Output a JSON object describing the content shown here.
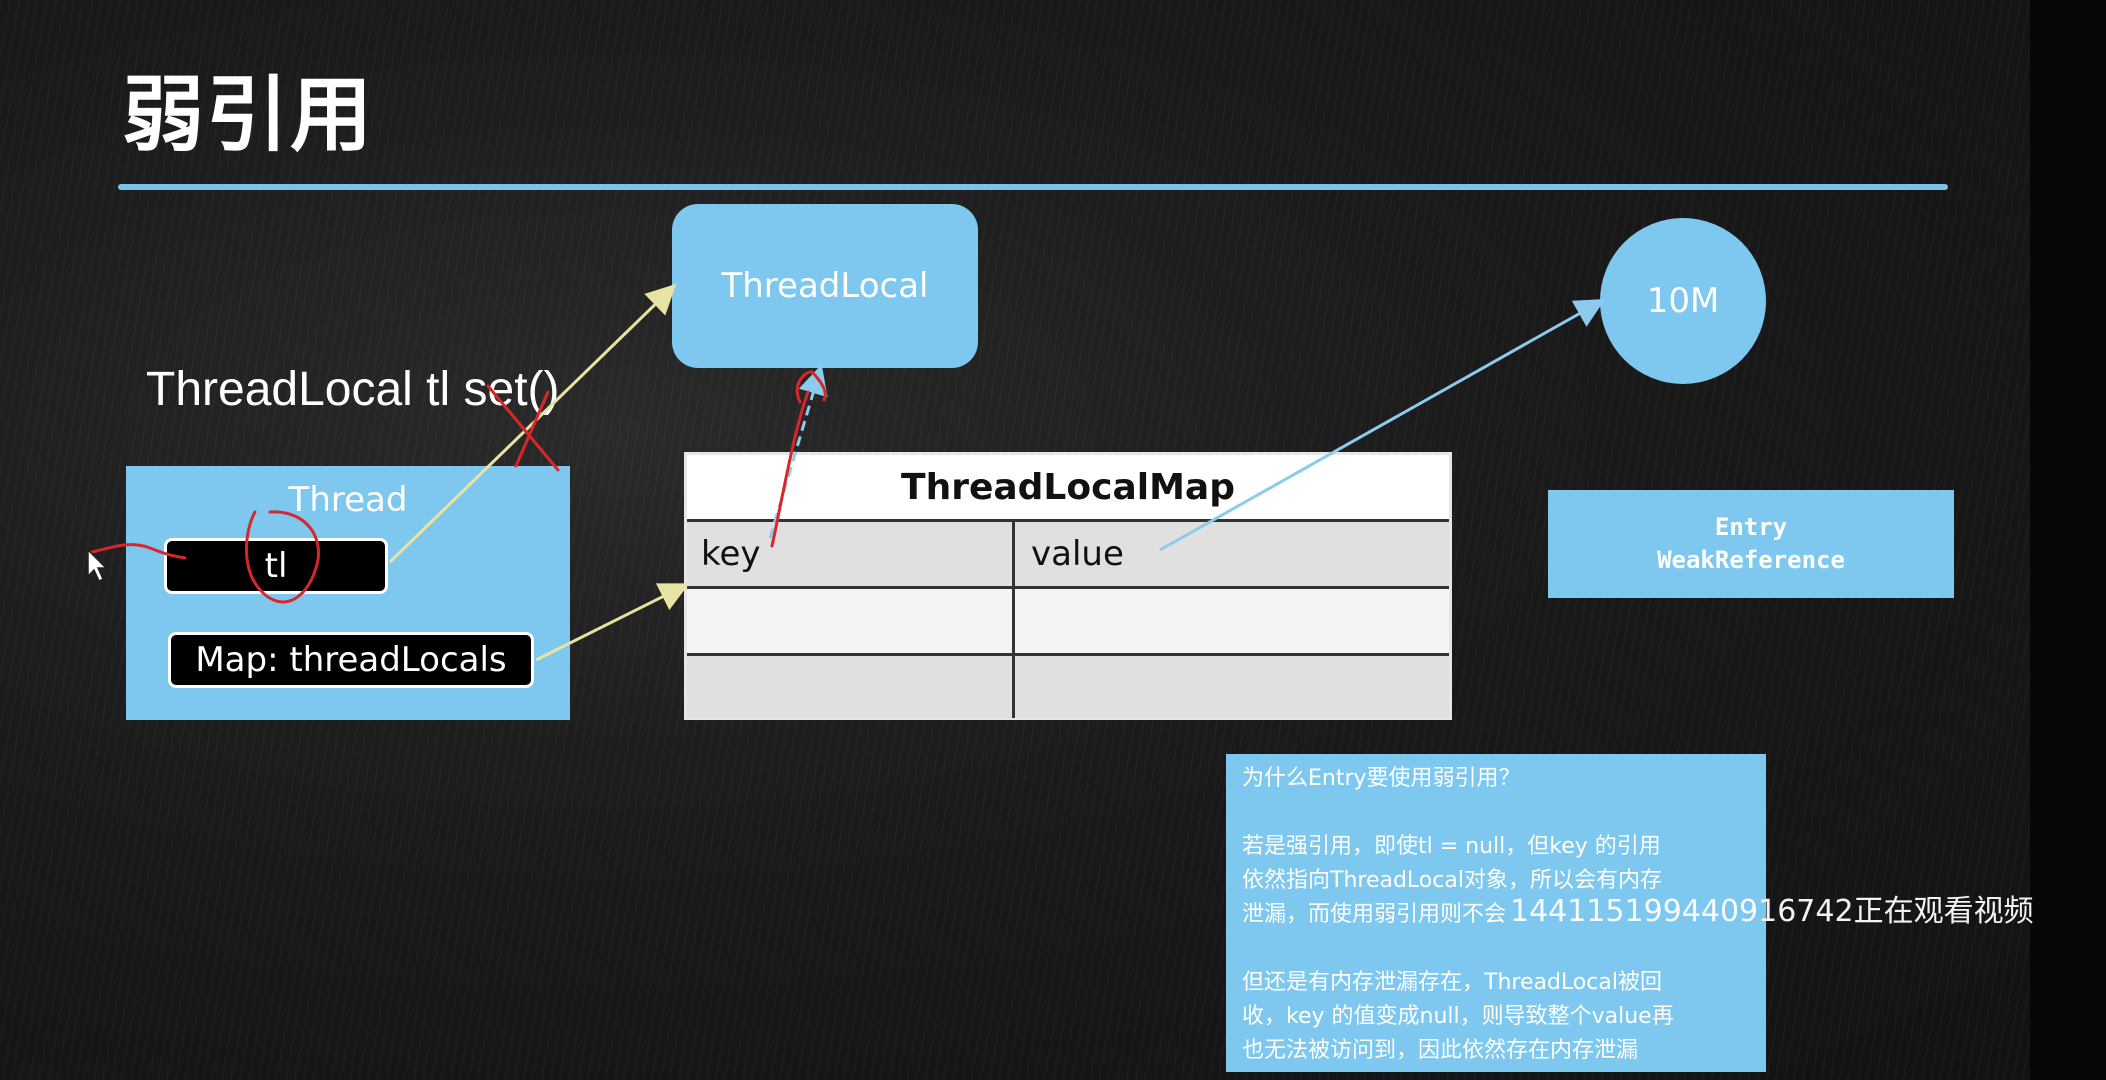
{
  "slide": {
    "title": "弱引用"
  },
  "diagram": {
    "threadlocal_node": "ThreadLocal",
    "big_object": "10M",
    "code_text": "ThreadLocal tl set()",
    "thread": {
      "label": "Thread",
      "tl_field": "tl",
      "map_field": "Map: threadLocals"
    },
    "map_table": {
      "title": "ThreadLocalMap",
      "rows": [
        [
          "key",
          "value"
        ],
        [
          "",
          ""
        ],
        [
          "",
          ""
        ]
      ]
    },
    "entry": {
      "line1": "Entry",
      "line2": "WeakReference"
    }
  },
  "note": {
    "question": "为什么Entry要使用弱引用？",
    "para1": [
      "若是强引用，即使tl = null，但key 的引用",
      "依然指向ThreadLocal对象，所以会有内存",
      "泄漏，而使用弱引用则不会"
    ],
    "para2": [
      "但还是有内存泄漏存在，ThreadLocal被回",
      "收，key 的值变成null，则导致整个value再",
      "也无法被访问到，因此依然存在内存泄漏"
    ]
  },
  "watermark": "14411519944091674​2正在观看视频",
  "colors": {
    "box_blue": "#7ec8ef",
    "arrow_yellow": "#e8e3a0",
    "arrow_blue": "#8ccbec",
    "annotation_red": "#d8262b",
    "background": "#1a1a1a"
  }
}
